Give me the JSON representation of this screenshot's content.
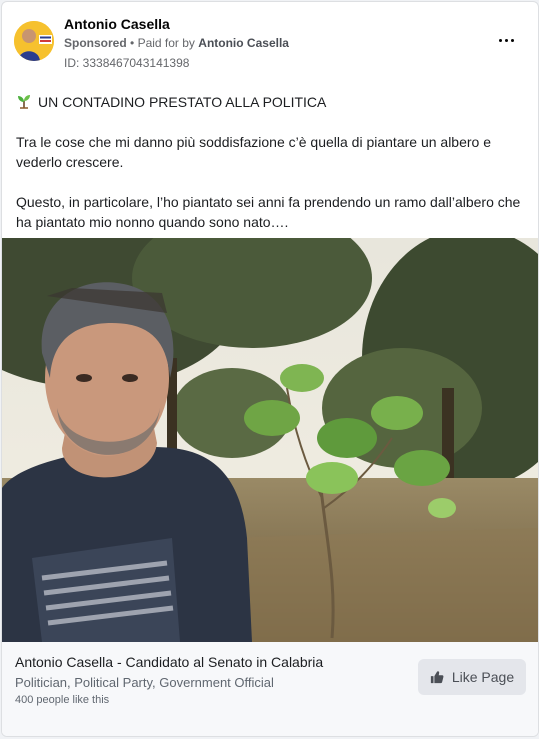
{
  "post": {
    "author": "Antonio Casella",
    "sponsored_label": "Sponsored",
    "paid_for_prefix": "Paid for by",
    "paid_for_by": "Antonio Casella",
    "ad_id": "ID: 3338467043141398",
    "more_icon": "more-options-icon",
    "headline": "UN CONTADINO PRESTATO ALLA POLITICA",
    "headline_icon": "seedling-icon",
    "paragraph_1": "Tra le cose che mi danno più soddisfazione c’è quella di piantare un albero e vederlo crescere.",
    "paragraph_2": "Questo, in particolare, l’ho piantato sei anni fa prendendo un ramo dall’albero che ha piantato mio nonno quando sono nato…."
  },
  "page_card": {
    "name": "Antonio Casella - Candidato al Senato in Calabria",
    "categories": "Politician, Political Party, Government Official",
    "likes": "400 people like this",
    "like_button_label": "Like Page",
    "like_icon": "thumbs-up-icon"
  },
  "colors": {
    "accent_yellow": "#f6c12e",
    "text_primary": "#050505",
    "text_secondary": "#65676b",
    "footer_bg": "#f7f8fa",
    "button_bg": "#e4e6eb"
  }
}
